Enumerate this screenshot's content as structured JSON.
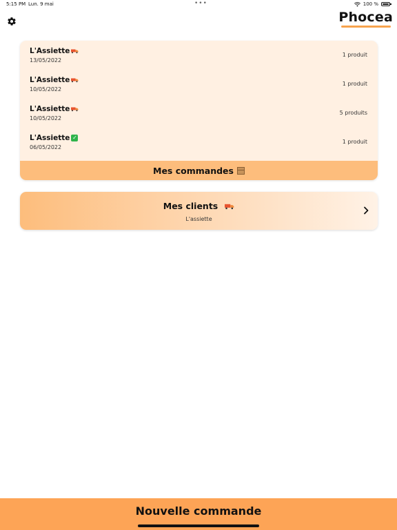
{
  "status_bar": {
    "time": "5:15 PM",
    "date": "Lun. 9 mai",
    "dots": "•••",
    "battery": "100 %"
  },
  "header": {
    "brand": "Phocea",
    "brand_underline_color": "#f7a34d",
    "settings_icon": "gear-icon"
  },
  "orders": {
    "items": [
      {
        "name": "L'Assiette",
        "status_icon": "delivery-truck-icon",
        "date": "13/05/2022",
        "count": "1 produit"
      },
      {
        "name": "L'Assiette",
        "status_icon": "delivery-truck-icon",
        "date": "10/05/2022",
        "count": "1 produit"
      },
      {
        "name": "L'Assiette",
        "status_icon": "delivery-truck-icon",
        "date": "10/05/2022",
        "count": "5 produits"
      },
      {
        "name": "L'Assiette",
        "status_icon": "check-mark-icon",
        "date": "06/05/2022",
        "count": "1 produit"
      }
    ],
    "footer_label": "Mes commandes",
    "footer_icon": "package-icon"
  },
  "clients": {
    "title": "Mes clients",
    "title_icon": "delivery-truck-icon",
    "subtitle": "L'assiette",
    "chevron_icon": "chevron-right-icon"
  },
  "bottom": {
    "new_order_label": "Nouvelle commande"
  },
  "colors": {
    "accent": "#fda456",
    "card_bg": "#fff0e2",
    "card_footer": "#fdbd7c"
  }
}
